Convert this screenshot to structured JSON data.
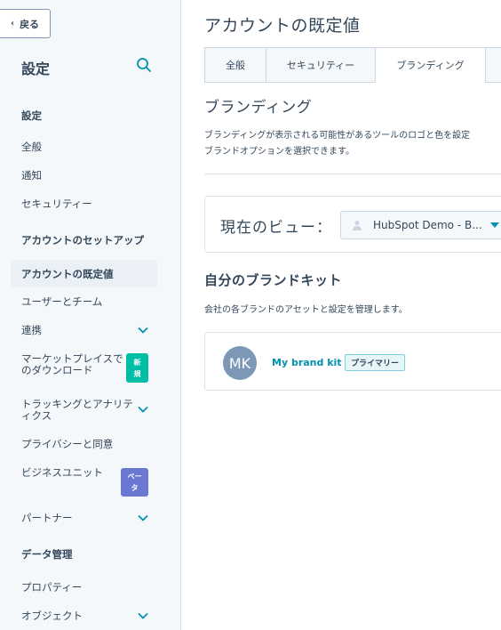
{
  "sidebar": {
    "back_label": "戻る",
    "title": "設定",
    "items": [
      {
        "label": "設定",
        "type": "section"
      },
      {
        "label": "全般",
        "type": "item"
      },
      {
        "label": "通知",
        "type": "item"
      },
      {
        "label": "セキュリティー",
        "type": "item"
      },
      {
        "label": "アカウントのセットアップ",
        "type": "section"
      },
      {
        "label": "アカウントの既定値",
        "type": "active"
      },
      {
        "label": "ユーザーとチーム",
        "type": "item"
      },
      {
        "label": "連携",
        "type": "expandable"
      },
      {
        "label_line1": "マーケットプレイスで",
        "label_line2": "のダウンロード",
        "type": "item",
        "badge": {
          "line1": "新",
          "line2": "規"
        }
      },
      {
        "label_line1": "トラッキングとアナリテ",
        "label_line2": "ィクス",
        "type": "expandable"
      },
      {
        "label": "プライバシーと同意",
        "type": "item"
      },
      {
        "label": "ビジネスユニット",
        "type": "item",
        "badge": {
          "line1": "ベー",
          "line2": "タ"
        }
      },
      {
        "label": "パートナー",
        "type": "expandable"
      },
      {
        "label": "データ管理",
        "type": "section"
      },
      {
        "label": "プロパティー",
        "type": "item"
      },
      {
        "label": "オブジェクト",
        "type": "expandable"
      }
    ]
  },
  "main": {
    "page_title": "アカウントの既定値",
    "tabs": [
      {
        "label": "全般",
        "active": false
      },
      {
        "label": "セキュリティー",
        "active": false
      },
      {
        "label": "ブランディング",
        "active": true
      },
      {
        "label": "",
        "active": false
      }
    ],
    "section_title": "ブランディング",
    "description_line1": "ブランディングが表示される可能性があるツールのロゴと色を設定",
    "description_line2": "ブランドオプションを選択できます。",
    "view_label": "現在のビュー：",
    "view_value": "HubSpot Demo - B...",
    "kit_title": "自分のブランドキット",
    "kit_description": "会社の各ブランドのアセットと設定を管理します。",
    "kit": {
      "avatar_initials": "MK",
      "name": "My brand kit",
      "tag": "プライマリー"
    }
  },
  "colors": {
    "accent": "#0091ae",
    "new_badge": "#00bda5",
    "beta_badge": "#6a78d1",
    "avatar": "#7c98b6",
    "text": "#33475b"
  }
}
